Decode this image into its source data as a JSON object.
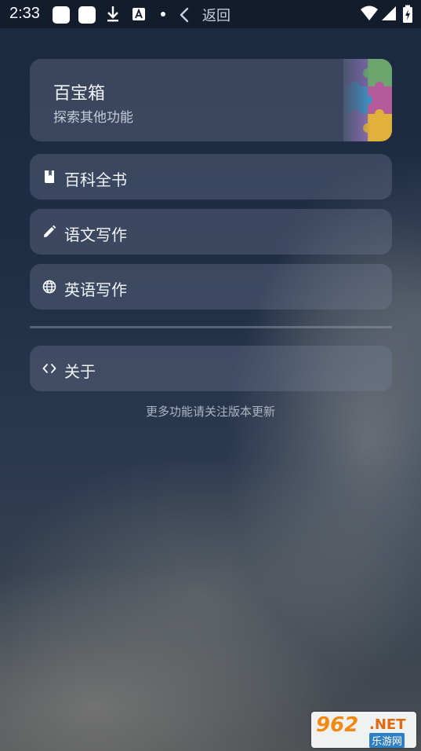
{
  "status_bar": {
    "time": "2:33"
  },
  "header": {
    "back_label": "返回"
  },
  "toolbox": {
    "title": "百宝箱",
    "subtitle": "探索其他功能"
  },
  "menu": {
    "items": [
      {
        "label": "百科全书",
        "icon": "book-icon"
      },
      {
        "label": "语文写作",
        "icon": "pencil-icon"
      },
      {
        "label": "英语写作",
        "icon": "globe-icon"
      }
    ],
    "about": {
      "label": "关于",
      "icon": "code-icon"
    }
  },
  "footer_hint": "更多功能请关注版本更新",
  "watermark": {
    "number": "962",
    "net": ".NET",
    "cn": "乐游网"
  },
  "colors": {
    "background": "#1c2a40",
    "panel": "rgba(120,132,155,0.32)",
    "text": "#eef1f6"
  }
}
